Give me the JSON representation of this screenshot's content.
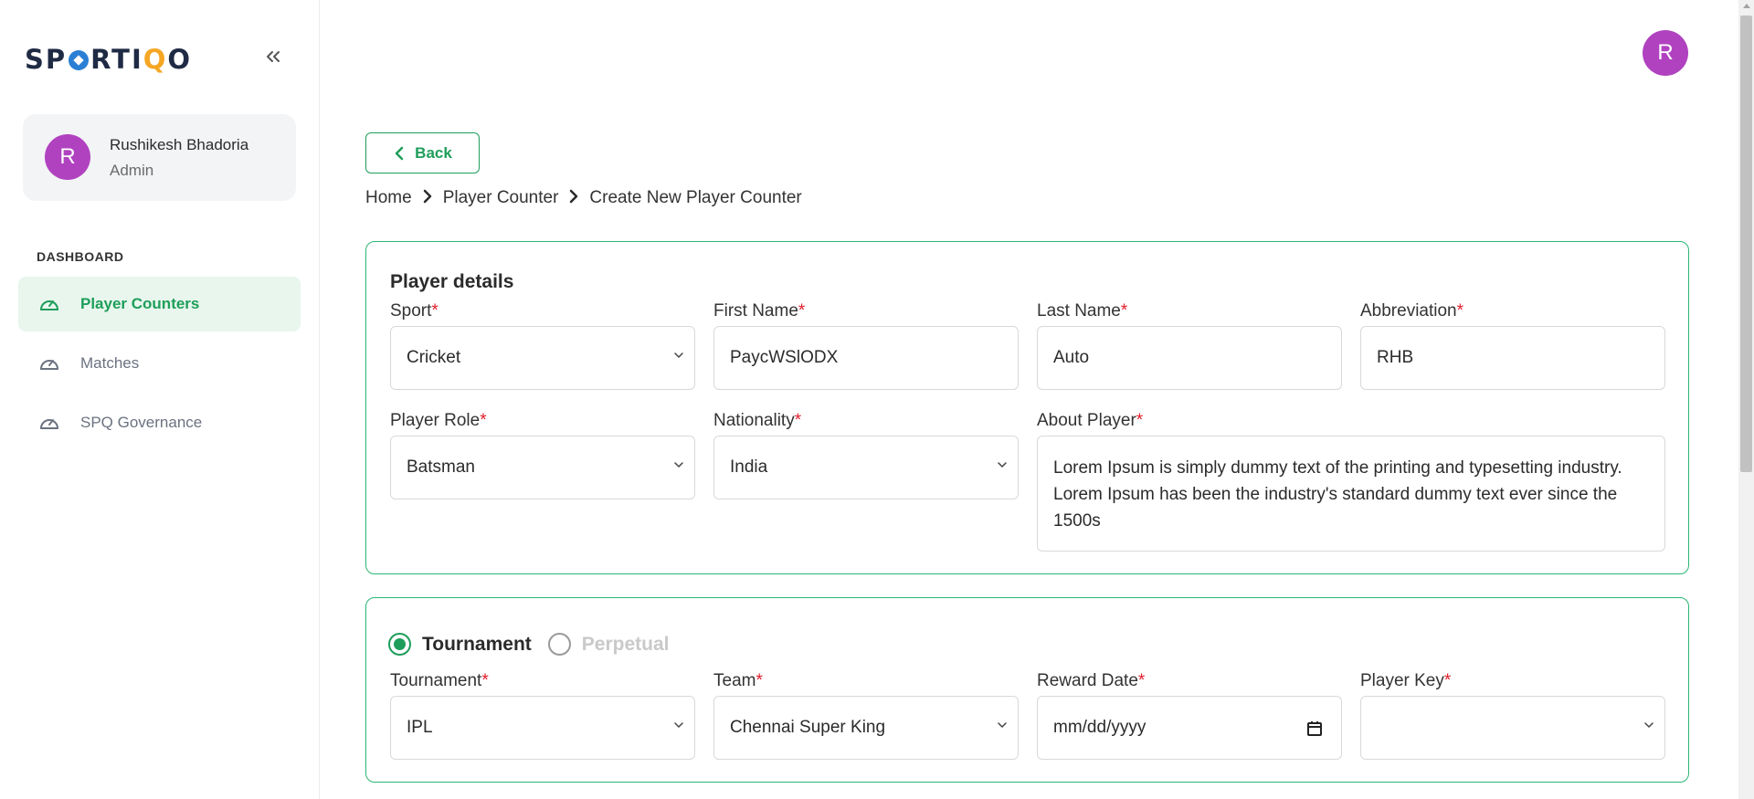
{
  "brand": {
    "logo_before": "SP",
    "logo_middle": "RTI",
    "logo_accent": "Q",
    "logo_after": "O"
  },
  "user": {
    "initial": "R",
    "name": "Rushikesh Bhadoria",
    "role": "Admin"
  },
  "sidebar": {
    "section_title": "DASHBOARD",
    "items": [
      {
        "label": "Player Counters",
        "active": true,
        "icon": "gauge-icon"
      },
      {
        "label": "Matches",
        "active": false,
        "icon": "gauge-icon"
      },
      {
        "label": "SPQ Governance",
        "active": false,
        "icon": "gauge-icon"
      }
    ]
  },
  "back_label": "Back",
  "breadcrumb": [
    "Home",
    "Player Counter",
    "Create New Player Counter"
  ],
  "player_details": {
    "title": "Player details",
    "sport": {
      "label": "Sport",
      "value": "Cricket"
    },
    "first_name": {
      "label": "First Name",
      "value": "PaycWSlODX"
    },
    "last_name": {
      "label": "Last Name",
      "value": "Auto"
    },
    "abbreviation": {
      "label": "Abbreviation",
      "value": "RHB"
    },
    "player_role": {
      "label": "Player Role",
      "value": "Batsman"
    },
    "nationality": {
      "label": "Nationality",
      "value": "India"
    },
    "about_player": {
      "label": "About Player",
      "value": "Lorem Ipsum is simply dummy text of the printing and typesetting industry. Lorem Ipsum has been the industry's standard dummy text ever since the 1500s"
    },
    "required_mark": "*"
  },
  "tournament_section": {
    "radio_tournament": "Tournament",
    "radio_perpetual": "Perpetual",
    "selected": "Tournament",
    "tournament": {
      "label": "Tournament",
      "value": "IPL"
    },
    "team": {
      "label": "Team",
      "value": "Chennai Super King"
    },
    "reward_date": {
      "label": "Reward Date",
      "placeholder": "mm/dd/yyyy"
    },
    "player_key": {
      "label": "Player Key",
      "value": ""
    }
  },
  "colors": {
    "accent": "#1e9e5a",
    "card_border": "#2bb673",
    "avatar": "#b042c0",
    "required": "#e11d2a"
  }
}
